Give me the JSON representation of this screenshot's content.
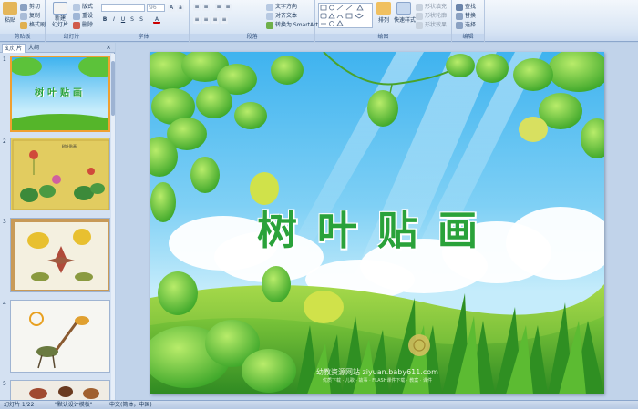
{
  "ribbon": {
    "clipboard": {
      "label": "剪贴板",
      "paste": "粘贴",
      "cut": "剪切",
      "copy": "复制",
      "format_painter": "格式刷"
    },
    "slides": {
      "label": "幻灯片",
      "new_slide": "新建",
      "new_slide_2": "幻灯片",
      "layout": "版式",
      "reset": "重设",
      "delete": "删除"
    },
    "font": {
      "label": "字体",
      "font_size": "96"
    },
    "paragraph": {
      "label": "段落",
      "text_direction": "文字方向",
      "align_text": "对齐文本",
      "smartart": "转换为 SmartArt"
    },
    "drawing": {
      "label": "绘图",
      "arrange": "排列",
      "quick_styles": "快速样式",
      "shape_fill": "形状填充",
      "shape_outline": "形状轮廓",
      "shape_effects": "形状效果"
    },
    "editing": {
      "label": "编辑",
      "find": "查找",
      "replace": "替换",
      "select": "选择"
    }
  },
  "panel": {
    "tabs": [
      "幻灯片",
      "大纲"
    ],
    "close": "×",
    "slide_numbers": [
      "1",
      "2",
      "3",
      "4",
      "5"
    ],
    "thumb1_title": "树叶贴画",
    "thumb2_title": "树叶贴画"
  },
  "slide": {
    "title": "树叶贴画",
    "watermark": "幼教资源网站 ziyuan.baby611.com",
    "watermark_sub": "优质下载 · 儿歌 · 故事 · FLASH课件下载 · 教案 · 课件"
  },
  "status": {
    "slide_info": "幻灯片 1/22",
    "theme": "\"默认设计模板\"",
    "language": "中文(简体，中国)"
  },
  "colors": {
    "title_green": "#2aa23a",
    "ribbon_bg": "#dbe7f5",
    "selected_border": "#f0a030"
  }
}
